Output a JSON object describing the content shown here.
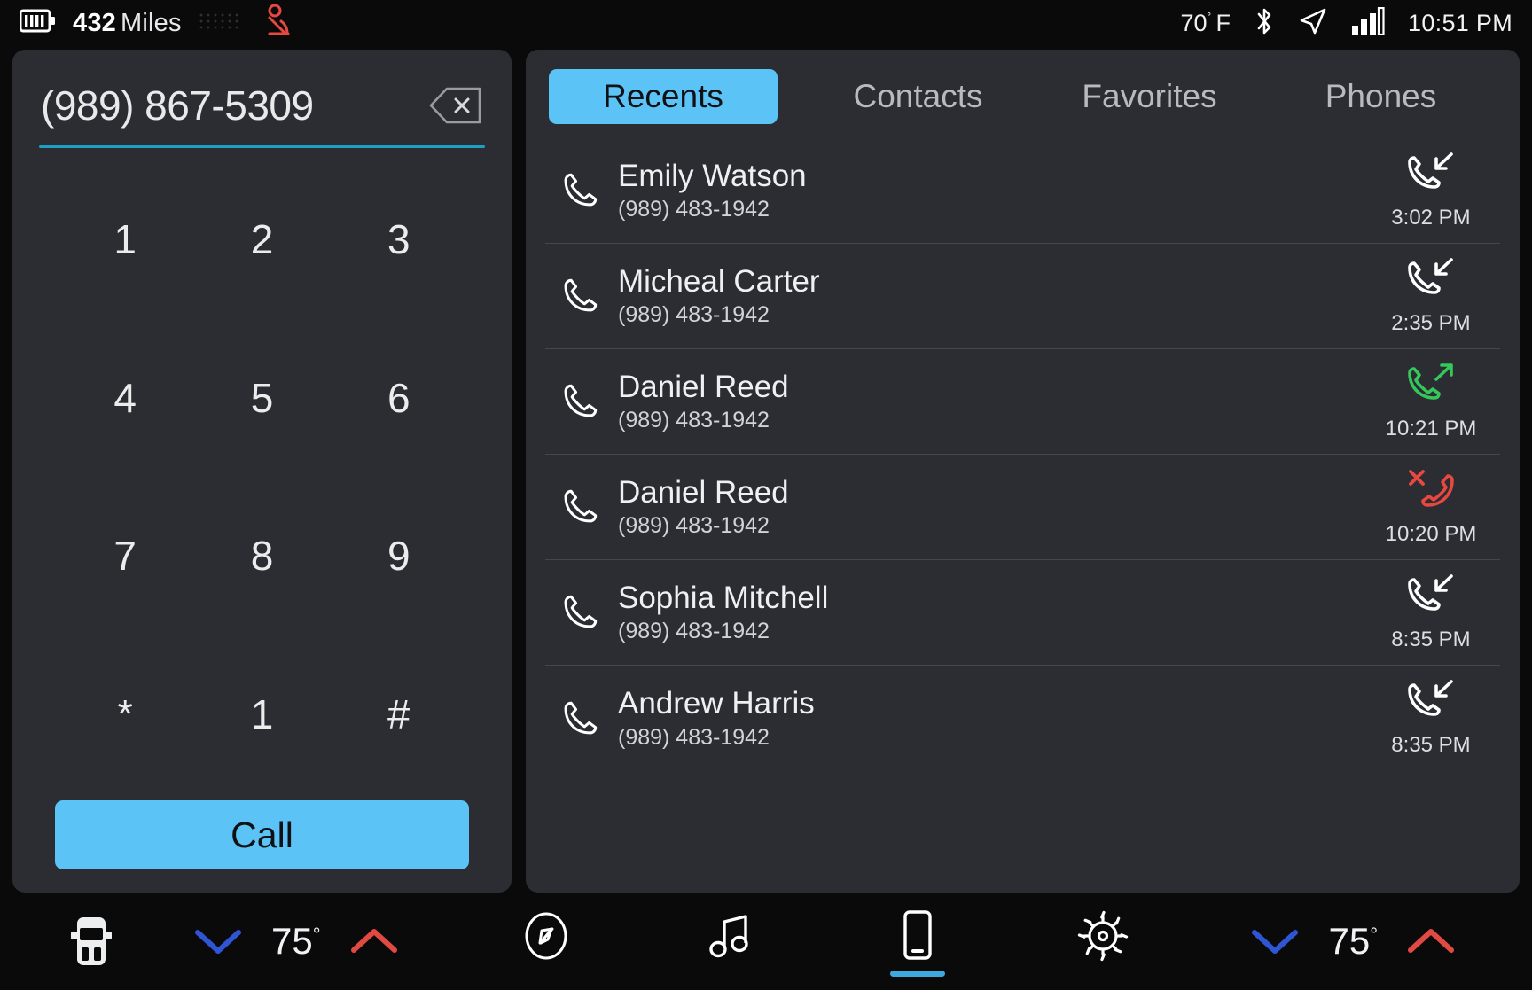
{
  "statusbar": {
    "battery_icon": "battery-icon",
    "range_value": "432",
    "range_unit": "Miles",
    "seatbelt_icon": "seatbelt-warning-icon",
    "outside_temp": "70",
    "temp_degree": "˚",
    "temp_unit": "F",
    "bluetooth_icon": "bluetooth-icon",
    "location_icon": "navigation-arrow-icon",
    "signal_icon": "cellular-signal-icon",
    "clock": "10:51 PM"
  },
  "dialpad": {
    "dialed_number": "(989) 867-5309",
    "backspace_icon": "backspace-delete-icon",
    "keys": [
      "1",
      "2",
      "3",
      "4",
      "5",
      "6",
      "7",
      "8",
      "9",
      "*",
      "1",
      "#"
    ],
    "call_label": "Call"
  },
  "tabs": [
    {
      "label": "Recents",
      "active": true
    },
    {
      "label": "Contacts",
      "active": false
    },
    {
      "label": "Favorites",
      "active": false
    },
    {
      "label": "Phones",
      "active": false
    }
  ],
  "recents": [
    {
      "name": "Emily Watson",
      "number": "(989) 483-1942",
      "direction": "incoming",
      "time": "3:02 PM"
    },
    {
      "name": "Micheal Carter",
      "number": "(989) 483-1942",
      "direction": "incoming",
      "time": "2:35 PM"
    },
    {
      "name": "Daniel Reed",
      "number": "(989) 483-1942",
      "direction": "outgoing",
      "time": "10:21 PM"
    },
    {
      "name": "Daniel Reed",
      "number": "(989) 483-1942",
      "direction": "missed",
      "time": "10:20 PM"
    },
    {
      "name": "Sophia Mitchell",
      "number": "(989) 483-1942",
      "direction": "incoming",
      "time": "8:35 PM"
    },
    {
      "name": "Andrew Harris",
      "number": "(989) 483-1942",
      "direction": "incoming",
      "time": "8:35 PM"
    }
  ],
  "bottombar": {
    "vehicle_icon": "vehicle-truck-icon",
    "left_temp": "75",
    "left_degree": "°",
    "right_temp": "75",
    "right_degree": "°",
    "down_chevron_icon": "chevron-down-icon",
    "up_chevron_icon": "chevron-up-icon",
    "nav_items": [
      {
        "icon": "compass-navigation-icon",
        "active": false
      },
      {
        "icon": "music-note-icon",
        "active": false
      },
      {
        "icon": "phone-device-icon",
        "active": true
      },
      {
        "icon": "gear-settings-icon",
        "active": false
      }
    ]
  },
  "colors": {
    "accent_blue": "#5bc3f5",
    "panel_bg": "#2b2d33",
    "screen_bg": "#0a0a0b",
    "incoming_white": "#ffffff",
    "outgoing_green": "#35c759",
    "missed_red": "#e8483f",
    "underline_teal": "#1f9fc4",
    "cool_blue": "#2f55d4",
    "heat_red": "#e04a43"
  }
}
